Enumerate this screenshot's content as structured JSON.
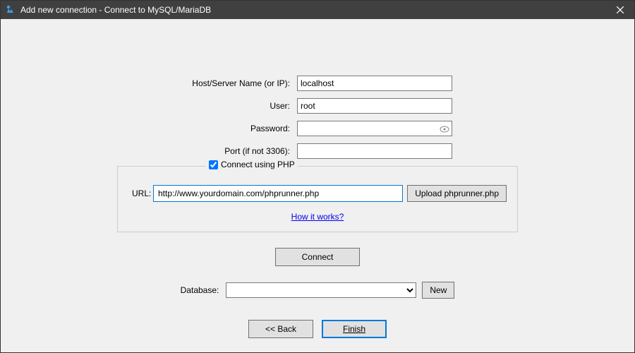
{
  "window": {
    "title": "Add new connection - Connect to MySQL/MariaDB"
  },
  "form": {
    "host_label": "Host/Server Name  (or IP):",
    "host_value": "localhost",
    "user_label": "User:",
    "user_value": "root",
    "password_label": "Password:",
    "password_value": "",
    "port_label": "Port (if not 3306):",
    "port_value": ""
  },
  "php": {
    "checkbox_label": "Connect using PHP",
    "checked": true,
    "url_label": "URL:",
    "url_value": "http://www.yourdomain.com/phprunner.php",
    "upload_btn": "Upload phprunner.php",
    "how_link": "How it works?"
  },
  "connect": {
    "button": "Connect"
  },
  "database": {
    "label": "Database:",
    "selected": "",
    "new_btn": "New"
  },
  "footer": {
    "back": "<< Back",
    "finish": "Finish"
  }
}
